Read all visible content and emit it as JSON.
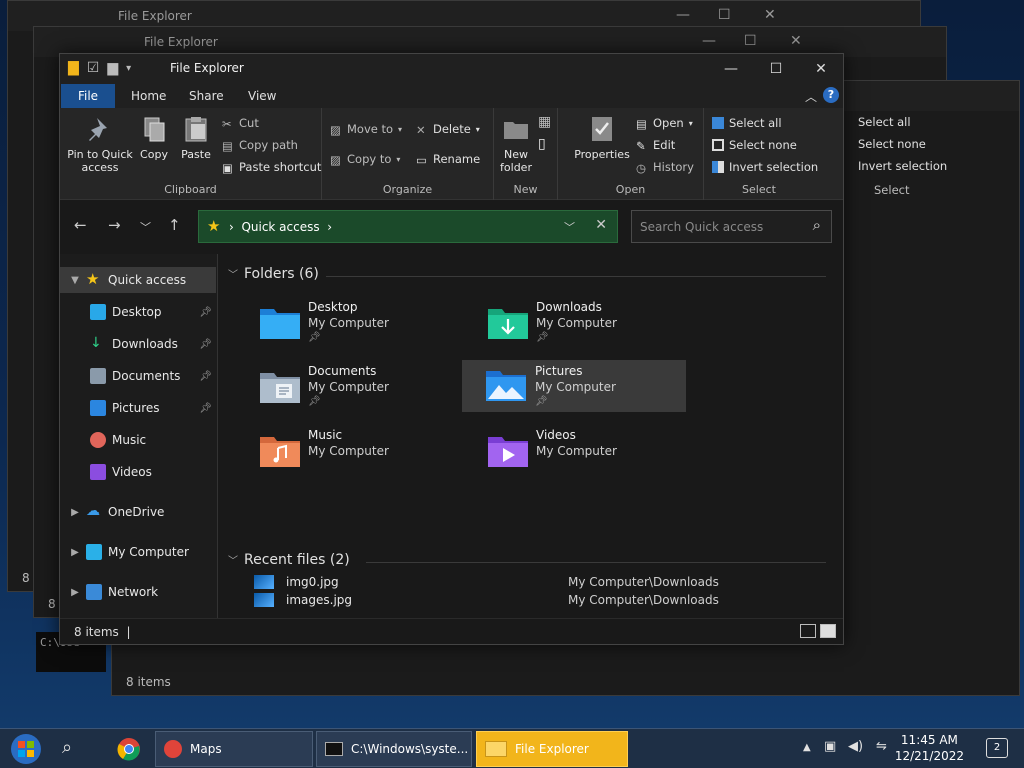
{
  "background_windows": {
    "title": "File Explorer",
    "status_count": "8 items",
    "ribbon_partial": [
      "Select all",
      "Select none",
      "Invert selection",
      "Select"
    ],
    "cmd_prompt": "C:\\Use"
  },
  "window": {
    "title": "File Explorer",
    "controls": {
      "minimize": "—",
      "maximize": "☐",
      "close": "✕"
    }
  },
  "tabs": [
    "File",
    "Home",
    "Share",
    "View"
  ],
  "ribbon": {
    "clipboard": {
      "label": "Clipboard",
      "pin": "Pin to Quick access",
      "copy": "Copy",
      "paste": "Paste",
      "cut": "Cut",
      "copy_path": "Copy path",
      "paste_shortcut": "Paste shortcut"
    },
    "organize": {
      "label": "Organize",
      "move_to": "Move to",
      "copy_to": "Copy to",
      "delete": "Delete",
      "rename": "Rename"
    },
    "new": {
      "label": "New",
      "new_folder": "New folder"
    },
    "open": {
      "label": "Open",
      "properties": "Properties",
      "open": "Open",
      "edit": "Edit",
      "history": "History"
    },
    "select": {
      "label": "Select",
      "select_all": "Select all",
      "select_none": "Select none",
      "invert": "Invert selection"
    }
  },
  "address": {
    "path": "Quick access",
    "search_placeholder": "Search Quick access"
  },
  "navpane": {
    "quick_access": "Quick access",
    "items": [
      "Desktop",
      "Downloads",
      "Documents",
      "Pictures",
      "Music",
      "Videos"
    ],
    "onedrive": "OneDrive",
    "my_computer": "My Computer",
    "network": "Network"
  },
  "folders": {
    "heading": "Folders (6)",
    "items": [
      {
        "name": "Desktop",
        "loc": "My Computer"
      },
      {
        "name": "Downloads",
        "loc": "My Computer"
      },
      {
        "name": "Documents",
        "loc": "My Computer"
      },
      {
        "name": "Pictures",
        "loc": "My Computer"
      },
      {
        "name": "Music",
        "loc": "My Computer"
      },
      {
        "name": "Videos",
        "loc": "My Computer"
      }
    ]
  },
  "recent": {
    "heading": "Recent files (2)",
    "items": [
      {
        "name": "images.jpg",
        "path": "My Computer\\Downloads"
      },
      {
        "name": "img0.jpg",
        "path": "My Computer\\Downloads"
      }
    ]
  },
  "status": {
    "count": "8 items"
  },
  "taskbar": {
    "tasks": [
      "Maps",
      "C:\\Windows\\syste...",
      "File Explorer"
    ],
    "time": "11:45 AM",
    "date": "12/21/2022",
    "notifications": "2"
  },
  "colors": {
    "accent": "#1a4f8f",
    "address_bg": "#1b4a2a",
    "taskbar_active": "#f2b51b"
  }
}
